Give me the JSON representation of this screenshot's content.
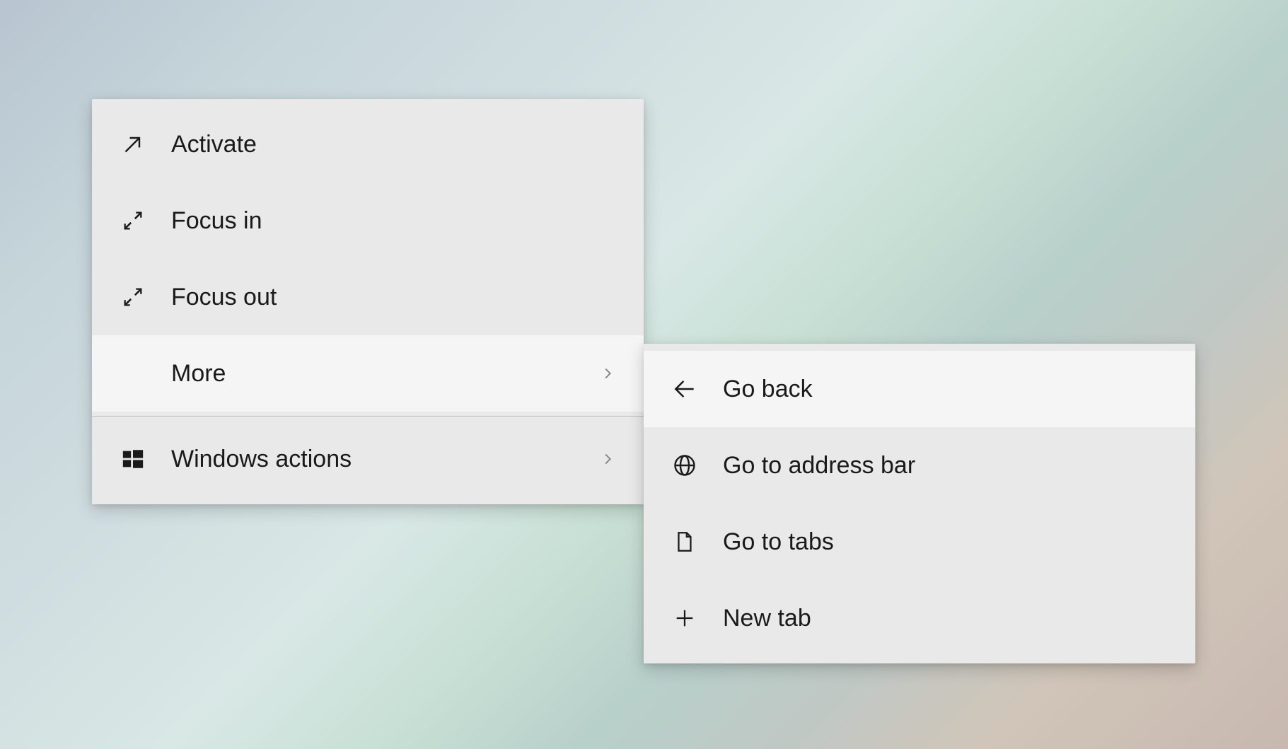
{
  "menu": {
    "items": [
      {
        "label": "Activate"
      },
      {
        "label": "Focus in"
      },
      {
        "label": "Focus out"
      },
      {
        "label": "More"
      },
      {
        "label": "Windows actions"
      }
    ]
  },
  "submenu": {
    "items": [
      {
        "label": "Go back"
      },
      {
        "label": "Go to address bar"
      },
      {
        "label": "Go to tabs"
      },
      {
        "label": "New tab"
      }
    ]
  }
}
